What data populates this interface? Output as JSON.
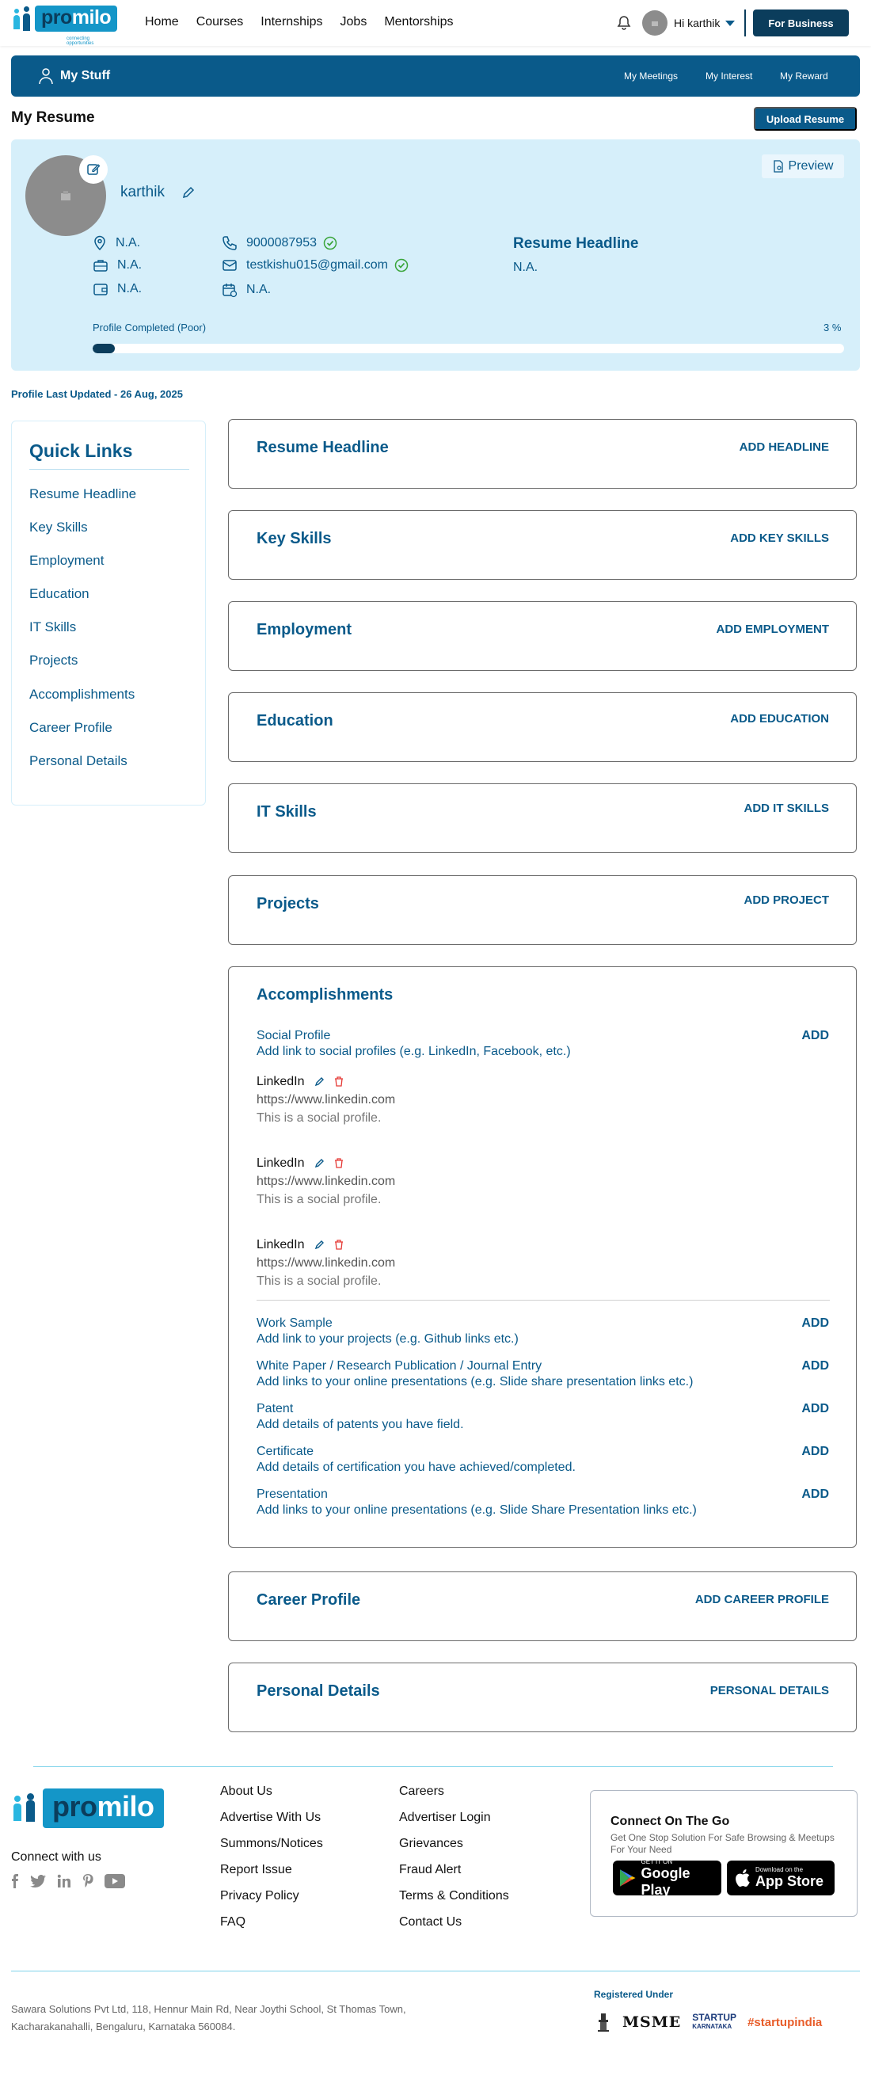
{
  "nav": {
    "menu": [
      "Home",
      "Courses",
      "Internships",
      "Jobs",
      "Mentorships"
    ],
    "logo_text_pro": "pro",
    "logo_text_milo": "milo",
    "logo_tagline": "connecting opportunities",
    "greeting": "Hi karthik",
    "for_business": "For Business"
  },
  "stuff_bar": {
    "title": "My Stuff",
    "links": [
      "My Meetings",
      "My Interest",
      "My Reward"
    ]
  },
  "page": {
    "title": "My Resume",
    "upload_button": "Upload Resume"
  },
  "profile": {
    "name": "karthik",
    "preview_label": "Preview",
    "location": "N.A.",
    "experience": "N.A.",
    "salary": "N.A.",
    "phone": "9000087953",
    "email": "testkishu015@gmail.com",
    "notice": "N.A.",
    "headline_title": "Resume Headline",
    "headline_value": "N.A.",
    "completion_label": "Profile Completed (Poor)",
    "completion_pct_text": "3 %",
    "completion_fraction": 0.03,
    "last_updated": "Profile Last Updated - 26 Aug, 2025"
  },
  "quick_links": {
    "title": "Quick Links",
    "items": [
      "Resume Headline",
      "Key Skills",
      "Employment",
      "Education",
      "IT Skills",
      "Projects",
      "Accomplishments",
      "Career Profile",
      "Personal Details"
    ]
  },
  "sections": [
    {
      "title": "Resume Headline",
      "action": "ADD HEADLINE"
    },
    {
      "title": "Key Skills",
      "action": "ADD KEY SKILLS"
    },
    {
      "title": "Employment",
      "action": "ADD EMPLOYMENT"
    },
    {
      "title": "Education",
      "action": "ADD EDUCATION"
    },
    {
      "title": "IT Skills",
      "action": "ADD IT SKILLS"
    },
    {
      "title": "Projects",
      "action": "ADD PROJECT"
    },
    {
      "title": "Career Profile",
      "action": "ADD CAREER PROFILE"
    },
    {
      "title": "Personal Details",
      "action": "PERSONAL DETAILS"
    }
  ],
  "accomplishments": {
    "title": "Accomplishments",
    "social_profile_title": "Social Profile",
    "social_profile_desc": "Add link to social profiles (e.g. LinkedIn, Facebook, etc.)",
    "add_label": "ADD",
    "profiles": [
      {
        "name": "LinkedIn",
        "url": "https://www.linkedin.com",
        "desc": "This is a social profile."
      },
      {
        "name": "LinkedIn",
        "url": "https://www.linkedin.com",
        "desc": "This is a social profile."
      },
      {
        "name": "LinkedIn",
        "url": "https://www.linkedin.com",
        "desc": "This is a social profile."
      }
    ],
    "others": [
      {
        "title": "Work Sample",
        "desc": "Add link to your projects (e.g. Github links etc.)"
      },
      {
        "title": "White Paper / Research Publication / Journal Entry",
        "desc": "Add links to your online presentations (e.g. Slide share presentation links etc.)"
      },
      {
        "title": "Patent",
        "desc": "Add details of patents you have field."
      },
      {
        "title": "Certificate",
        "desc": "Add details of certification you have achieved/completed."
      },
      {
        "title": "Presentation",
        "desc": "Add links to your online presentations (e.g. Slide Share Presentation links etc.)"
      }
    ]
  },
  "footer": {
    "connect_with_us": "Connect with us",
    "col1": [
      "About Us",
      "Advertise With Us",
      "Summons/Notices",
      "Report Issue",
      "Privacy Policy",
      "FAQ"
    ],
    "col2": [
      "Careers",
      "Advertiser Login",
      "Grievances",
      "Fraud Alert",
      "Terms & Conditions",
      "Contact Us"
    ],
    "go_title": "Connect On The Go",
    "go_subtitle": "Get One Stop Solution For Safe Browsing & Meetups For Your Need",
    "google_small": "GET IT ON",
    "google_big": "Google Play",
    "apple_small": "Download on the",
    "apple_big": "App Store",
    "address_line1": "Sawara Solutions Pvt Ltd, 118, Hennur Main Rd, Near Joythi School, St Thomas Town,",
    "address_line2": "Kacharakanahalli, Bengaluru, Karnataka 560084.",
    "registered_under": "Registered Under",
    "msme": "MSME",
    "startup_karnataka_1": "STARTUP",
    "startup_karnataka_2": "KARNATAKA",
    "startup_india": "#startupindia"
  },
  "colors": {
    "brand_dark": "#0a5a8a",
    "brand_navy": "#0b3d5c",
    "card_bg": "#d6effa",
    "verified_green": "#3aa53a",
    "delete_red": "#e53935"
  }
}
